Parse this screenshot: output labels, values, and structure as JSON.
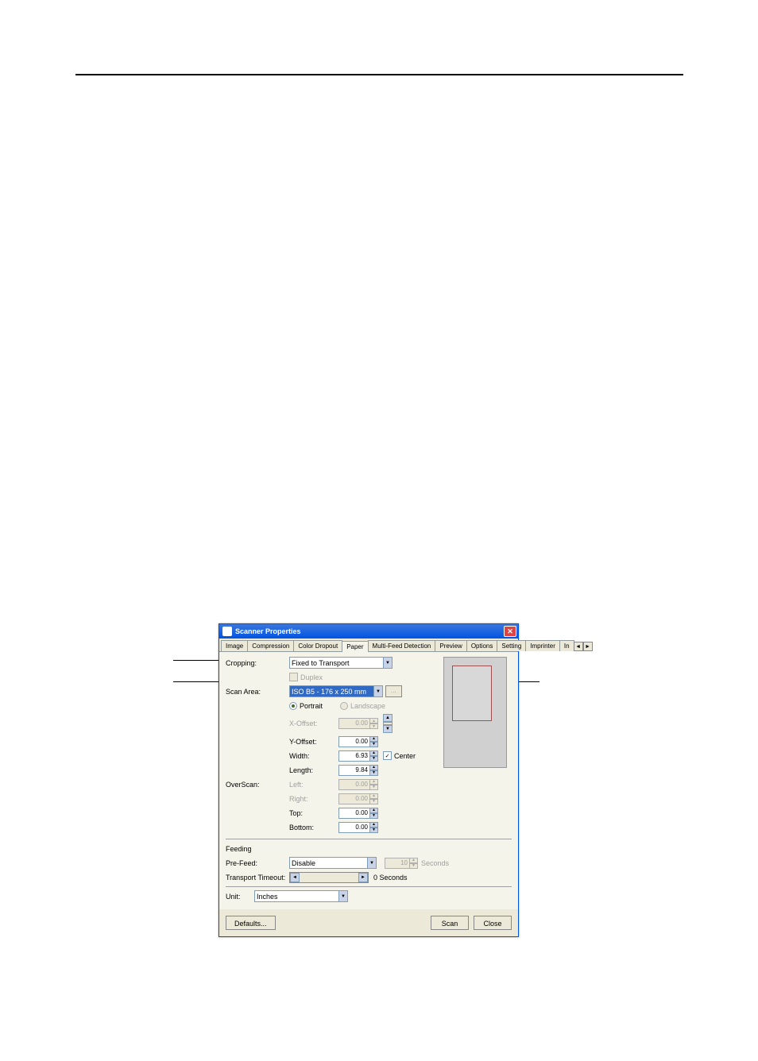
{
  "titlebar": {
    "title": "Scanner Properties",
    "close": "✕"
  },
  "tabs": {
    "items": [
      "Image",
      "Compression",
      "Color Dropout",
      "Paper",
      "Multi-Feed Detection",
      "Preview",
      "Options",
      "Setting",
      "Imprinter",
      "In"
    ],
    "active_index": 3,
    "scroll_left": "◄",
    "scroll_right": "►"
  },
  "cropping": {
    "label": "Cropping:",
    "value": "Fixed to Transport",
    "duplex_label": "Duplex"
  },
  "scan_area": {
    "label": "Scan Area:",
    "value": "ISO B5 - 176 x 250 mm",
    "ellipsis": "...",
    "portrait": "Portrait",
    "landscape": "Landscape",
    "x_offset_label": "X-Offset:",
    "x_offset": "0.00",
    "y_offset_label": "Y-Offset:",
    "y_offset": "0.00",
    "width_label": "Width:",
    "width": "6.93",
    "length_label": "Length:",
    "length": "9.84",
    "center_label": "Center"
  },
  "overscan": {
    "label": "OverScan:",
    "left_label": "Left:",
    "left": "0.00",
    "right_label": "Right:",
    "right": "0.00",
    "top_label": "Top:",
    "top": "0.00",
    "bottom_label": "Bottom:",
    "bottom": "0.00"
  },
  "feeding": {
    "heading": "Feeding",
    "prefeed_label": "Pre-Feed:",
    "prefeed_value": "Disable",
    "prefeed_seconds": "10",
    "seconds_label": "Seconds",
    "timeout_label": "Transport Timeout:",
    "timeout_value": "0 Seconds"
  },
  "unit": {
    "label": "Unit:",
    "value": "Inches"
  },
  "buttons": {
    "defaults": "Defaults...",
    "scan": "Scan",
    "close": "Close"
  }
}
